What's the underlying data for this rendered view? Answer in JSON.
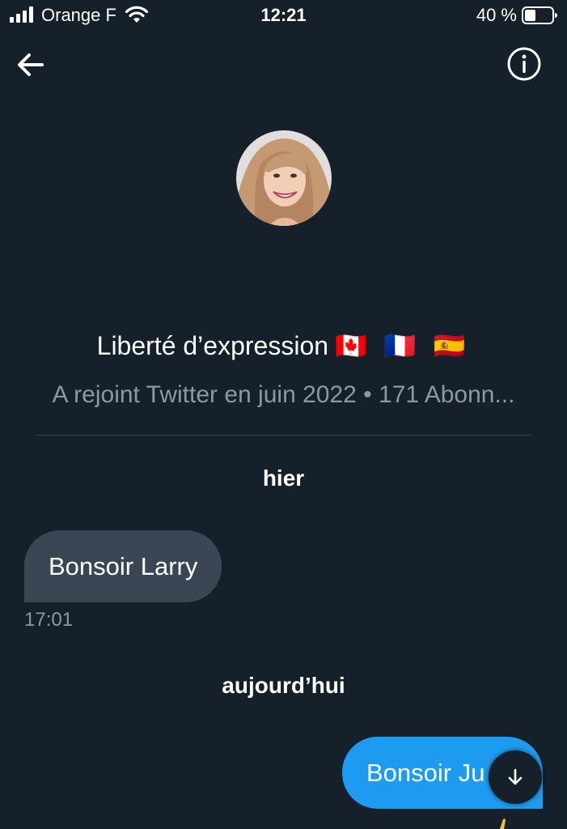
{
  "status_bar": {
    "carrier": "Orange F",
    "time": "12:21",
    "battery": "40 %",
    "battery_level": 0.4
  },
  "header": {
    "back_icon": "arrow-left-icon",
    "info_icon": "info-circle-icon"
  },
  "profile": {
    "name": "Liberté d’expression",
    "flags": "🇨🇦 🇫🇷 🇪🇸",
    "meta": "A rejoint Twitter en juin 2022 • 171 Abonn..."
  },
  "conversation": {
    "days": [
      {
        "label": "hier"
      },
      {
        "label": "aujourd’hui"
      }
    ],
    "messages": [
      {
        "text": "Bonsoir Larry",
        "time": "17:01",
        "direction": "incoming"
      },
      {
        "text": "Bonsoir Ju",
        "direction": "outgoing"
      }
    ],
    "scroll_down_icon": "arrow-down-icon"
  },
  "colors": {
    "background": "#15202b",
    "incoming_bubble": "#3a4654",
    "outgoing_bubble": "#1d9bf0",
    "secondary_text": "#8b98a5"
  }
}
